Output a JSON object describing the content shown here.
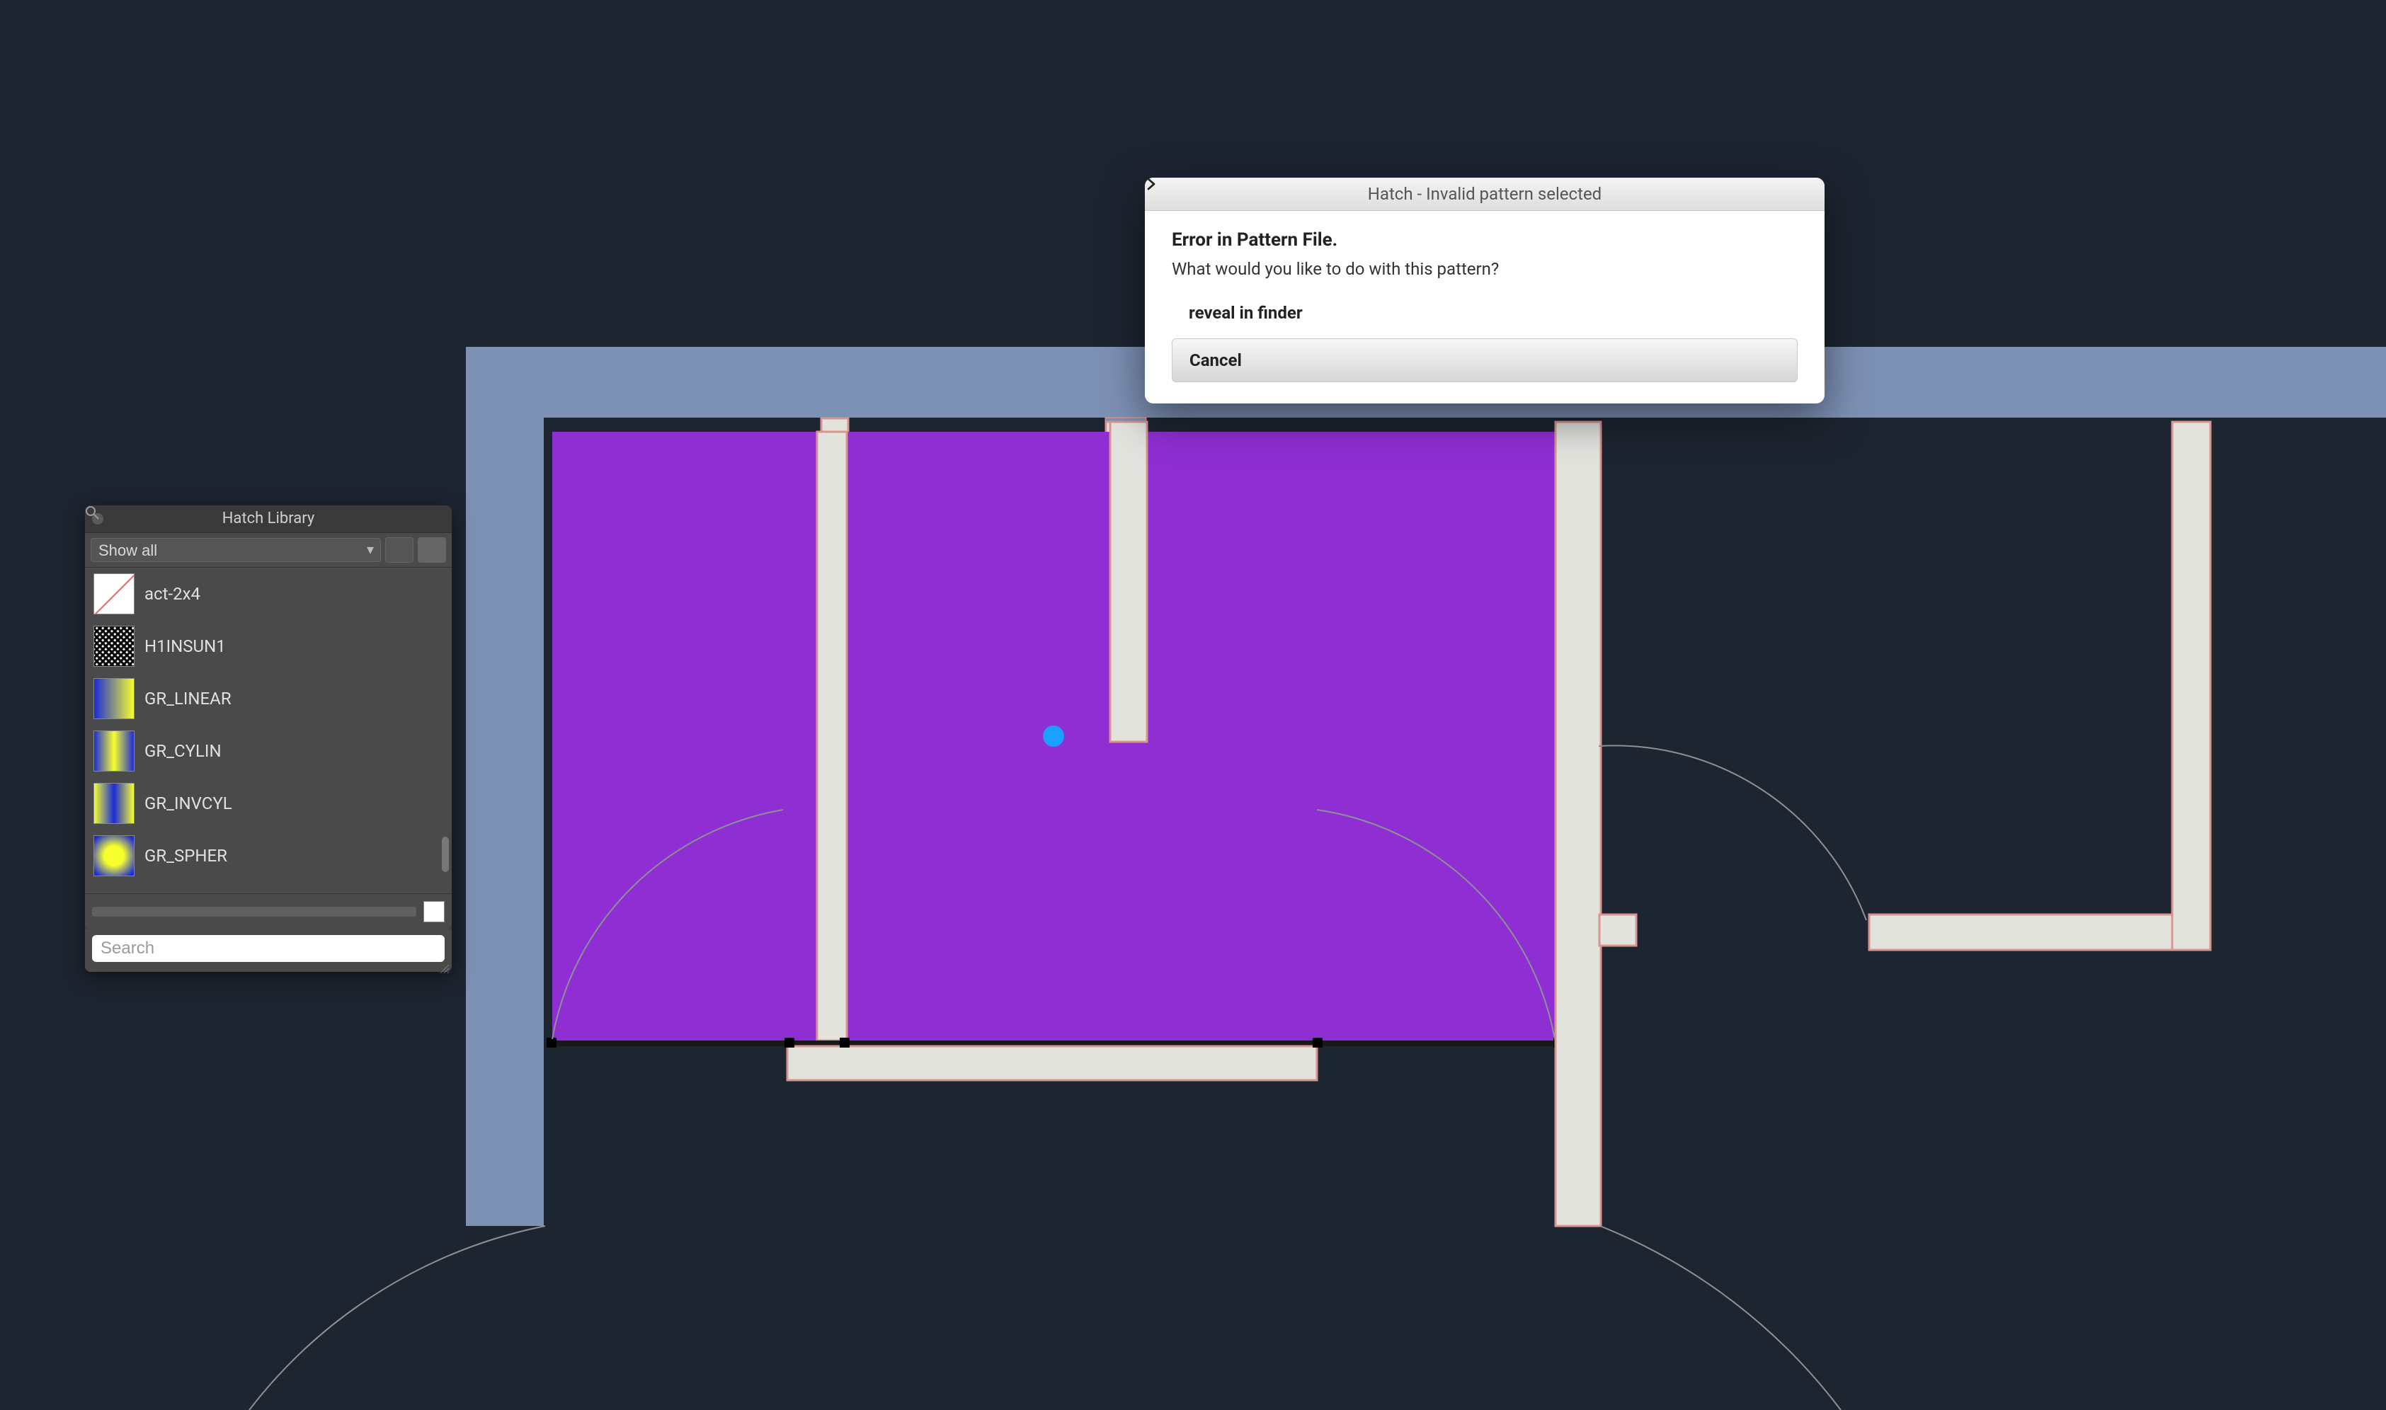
{
  "panel": {
    "title": "Hatch Library",
    "filter_selected": "Show all",
    "items": [
      {
        "name": "act-2x4",
        "swatch": "diag"
      },
      {
        "name": "H1INSUN1",
        "swatch": "hatch"
      },
      {
        "name": "GR_LINEAR",
        "swatch": "linear"
      },
      {
        "name": "GR_CYLIN",
        "swatch": "cylin"
      },
      {
        "name": "GR_INVCYL",
        "swatch": "invcyl"
      },
      {
        "name": "GR_SPHER",
        "swatch": "spher"
      }
    ],
    "search_placeholder": "Search"
  },
  "dialog": {
    "title": "Hatch - Invalid pattern selected",
    "heading": "Error in Pattern File.",
    "message": "What would you like to do with this pattern?",
    "option_reveal": "reveal in finder",
    "option_cancel": "Cancel"
  },
  "colors": {
    "bg": "#1d2531",
    "frame": "#7d91b4",
    "wall": "#e3e3de",
    "wall_edge": "#d9948f",
    "fill": "#8f2fd3",
    "arc": "#8d9196",
    "marker": "#1aa0ff"
  }
}
